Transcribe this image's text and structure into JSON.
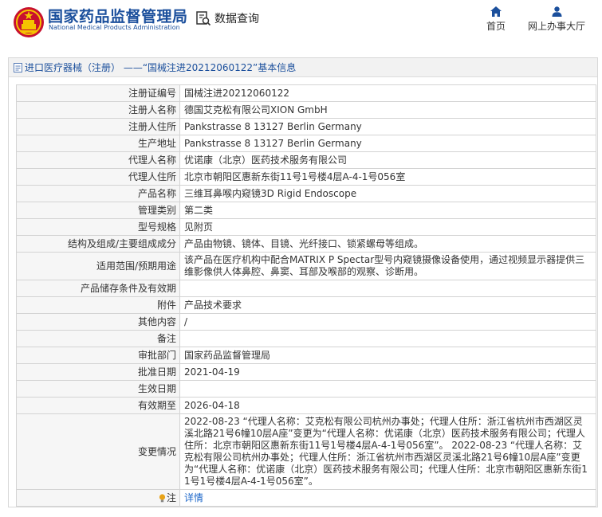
{
  "header": {
    "site_name_cn": "国家药品监督管理局",
    "site_name_en": "National Medical Products Administration",
    "data_query": "数据查询",
    "nav": [
      {
        "label": "首页",
        "icon": "home-icon"
      },
      {
        "label": "网上办事大厅",
        "icon": "user-icon"
      }
    ]
  },
  "panel": {
    "title": "进口医疗器械（注册） ——“国械注进20212060122”基本信息"
  },
  "rows": [
    {
      "label": "注册证编号",
      "value": "国械注进20212060122"
    },
    {
      "label": "注册人名称",
      "value": "德国艾克松有限公司XION GmbH"
    },
    {
      "label": "注册人住所",
      "value": "Pankstrasse 8 13127 Berlin Germany"
    },
    {
      "label": "生产地址",
      "value": "Pankstrasse 8 13127 Berlin Germany"
    },
    {
      "label": "代理人名称",
      "value": "优诺康（北京）医药技术服务有限公司"
    },
    {
      "label": "代理人住所",
      "value": "北京市朝阳区惠新东街11号1号楼4层A-4-1号056室"
    },
    {
      "label": "产品名称",
      "value": "三维耳鼻喉内窥镜3D Rigid Endoscope"
    },
    {
      "label": "管理类别",
      "value": "第二类"
    },
    {
      "label": "型号规格",
      "value": "见附页"
    },
    {
      "label": "结构及组成/主要组成成分",
      "value": "产品由物镜、镜体、目镜、光纤接口、锁紧螺母等组成。"
    },
    {
      "label": "适用范围/预期用途",
      "value": "该产品在医疗机构中配合MATRIX P Spectar型号内窥镜摄像设备使用，通过视频显示器提供三维影像供人体鼻腔、鼻窦、耳部及喉部的观察、诊断用。"
    },
    {
      "label": "产品储存条件及有效期",
      "value": ""
    },
    {
      "label": "附件",
      "value": "产品技术要求"
    },
    {
      "label": "其他内容",
      "value": "/"
    },
    {
      "label": "备注",
      "value": ""
    },
    {
      "label": "审批部门",
      "value": "国家药品监督管理局"
    },
    {
      "label": "批准日期",
      "value": "2021-04-19"
    },
    {
      "label": "生效日期",
      "value": ""
    },
    {
      "label": "有效期至",
      "value": "2026-04-18"
    },
    {
      "label": "变更情况",
      "value": "2022-08-23 “代理人名称：艾克松有限公司杭州办事处；代理人住所：浙江省杭州市西湖区灵溪北路21号6幢10层A座”变更为“代理人名称：优诺康（北京）医药技术服务有限公司；代理人住所：北京市朝阳区惠新东街11号1号楼4层A-4-1号056室”。 2022-08-23 “代理人名称：艾克松有限公司杭州办事处；代理人住所：浙江省杭州市西湖区灵溪北路21号6幢10层A座”变更为“代理人名称：优诺康（北京）医药技术服务有限公司；代理人住所：北京市朝阳区惠新东街11号1号楼4层A-4-1号056室”。"
    }
  ],
  "note": {
    "label": "注",
    "link_text": "详情"
  }
}
